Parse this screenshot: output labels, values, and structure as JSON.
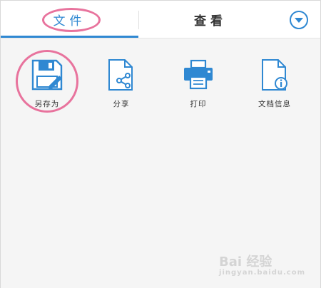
{
  "tabs": {
    "file_label": "文件",
    "view_label": "查看"
  },
  "toolbar": {
    "items": [
      {
        "label": "另存为",
        "icon": "save-as-icon"
      },
      {
        "label": "分享",
        "icon": "share-icon"
      },
      {
        "label": "打印",
        "icon": "printer-icon"
      },
      {
        "label": "文档信息",
        "icon": "document-info-icon"
      }
    ]
  },
  "watermark": {
    "text": "Bai 经验",
    "sub": "jingyan.baidu.com"
  },
  "colors": {
    "accent": "#2f88d2",
    "highlight": "#e8739d",
    "background": "#f5f5f5"
  }
}
